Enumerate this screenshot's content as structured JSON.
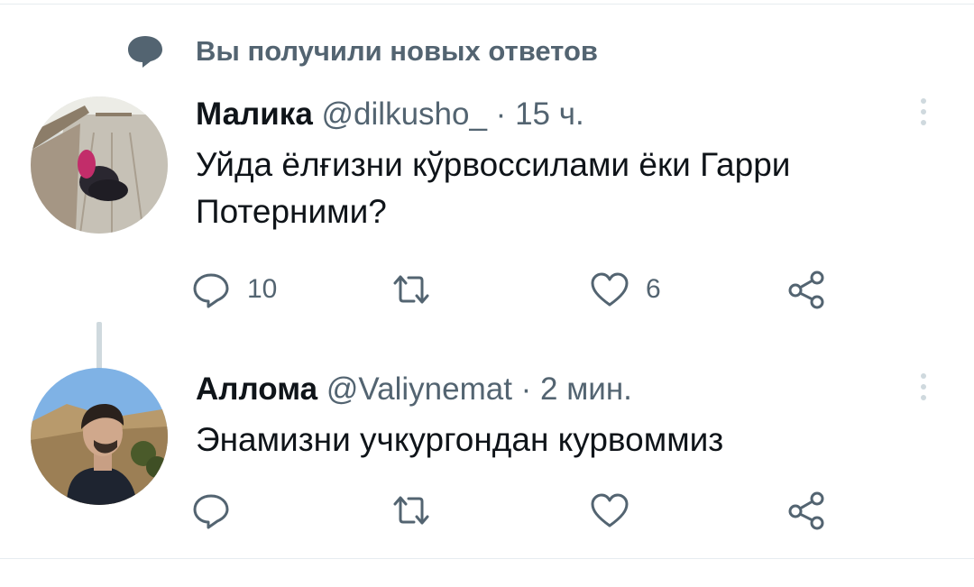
{
  "social_context": {
    "text": "Вы получили новых ответов",
    "icon": "speech-bubble-icon"
  },
  "tweets": [
    {
      "name": "Малика",
      "handle": "@dilkusho_",
      "separator": "·",
      "time": "15 ч.",
      "text": "Уйда ёлғизни кўрвоссилами ёки Гарри Потерними?",
      "replies": "10",
      "retweets": "",
      "likes": "6"
    },
    {
      "name": "Аллома",
      "handle": "@Valiynemat",
      "separator": "·",
      "time": "2 мин.",
      "text": "Энамизни учкургондан курвоммиз",
      "replies": "",
      "retweets": "",
      "likes": ""
    }
  ],
  "colors": {
    "text": "#0f1419",
    "secondary": "#536471",
    "divider": "#e6ecf0",
    "thread_line": "#cfd9de"
  }
}
